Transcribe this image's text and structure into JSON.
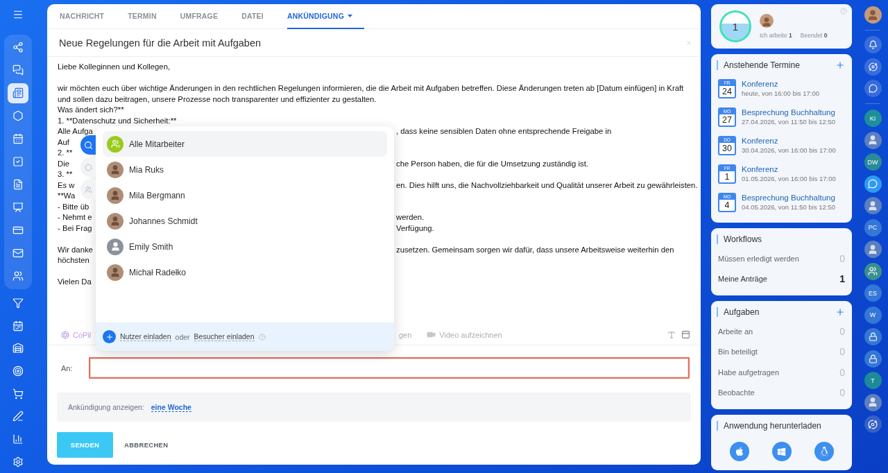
{
  "sidebar": {
    "items": [
      {
        "grouped": true,
        "selected": false
      },
      {
        "grouped": true,
        "selected": false
      },
      {
        "grouped": true,
        "selected": true
      },
      {
        "grouped": true,
        "selected": false
      },
      {
        "grouped": true,
        "selected": false
      },
      {
        "grouped": true,
        "selected": false
      },
      {
        "grouped": true,
        "selected": false
      },
      {
        "grouped": true,
        "selected": false
      },
      {
        "grouped": true,
        "selected": false
      },
      {
        "grouped": true,
        "selected": false
      },
      {
        "grouped": true,
        "selected": false
      },
      {
        "grouped": false,
        "selected": false
      },
      {
        "grouped": false,
        "selected": false
      },
      {
        "grouped": false,
        "selected": false
      },
      {
        "grouped": false,
        "selected": false
      },
      {
        "grouped": false,
        "selected": false
      },
      {
        "grouped": false,
        "selected": false
      },
      {
        "grouped": false,
        "selected": false
      },
      {
        "grouped": false,
        "selected": false
      }
    ]
  },
  "tabs": [
    {
      "label": "NACHRICHT",
      "selected": false,
      "has_menu": false
    },
    {
      "label": "TERMIN",
      "selected": false,
      "has_menu": false
    },
    {
      "label": "UMFRAGE",
      "selected": false,
      "has_menu": false
    },
    {
      "label": "DATEI",
      "selected": false,
      "has_menu": false
    },
    {
      "label": "ANKÜNDIGUNG",
      "selected": true,
      "has_menu": true
    }
  ],
  "title": "Neue Regelungen für die Arbeit mit Aufgaben",
  "body_lines": [
    {
      "left": "Liebe Kolleginnen und Kollegen,"
    },
    {
      "left": "wir möchten euch über wichtige Änderungen in den rechtlichen Regelungen informieren, die die Arbeit mit Aufgaben betreffen. Diese Änderungen treten ab [Datum einfügen] in Kraft",
      "space_before": true
    },
    {
      "left": "und sollen dazu beitragen, unsere Prozesse noch transparenter und effizienter zu gestalten."
    },
    {
      "left": "Was ändert sich?**"
    },
    {
      "left": "1. **Datenschutz und Sicherheit:**"
    },
    {
      "left": "Alle Aufga",
      "right": ", dass keine sensiblen Daten ohne entsprechende Freigabe in"
    },
    {
      "left": "Auf"
    },
    {
      "left": "2. **"
    },
    {
      "left": "Die",
      "right": "che Person haben, die für die Umsetzung zuständig ist."
    },
    {
      "left": "3. **"
    },
    {
      "left": "Es w",
      "right": "en. Dies hilft uns, die Nachvollziehbarkeit und Qualität unserer Arbeit zu gewährleisten."
    },
    {
      "left": "**Wa"
    },
    {
      "left": "- Bitte üb"
    },
    {
      "left": "- Nehmt e",
      "right": "werden."
    },
    {
      "left": "- Bei Frag",
      "right": "Verfügung."
    },
    {
      "left": "Wir danke",
      "space_before": true,
      "right": "zusetzen. Gemeinsam sorgen wir dafür, dass unsere Arbeitsweise weiterhin den"
    },
    {
      "left": "höchsten"
    },
    {
      "left": "Vielen Da",
      "space_before": true
    }
  ],
  "toolbar": {
    "copilot": "CoPil",
    "fragment": "gen",
    "video": "Video aufzeichnen"
  },
  "popup": {
    "items": [
      {
        "name": "Alle Mitarbeiter",
        "kind": "group",
        "selected": true
      },
      {
        "name": "Mia Ruks",
        "kind": "photo",
        "selected": false
      },
      {
        "name": "Mila Bergmann",
        "kind": "photo",
        "selected": false
      },
      {
        "name": "Johannes Schmidt",
        "kind": "photo",
        "selected": false
      },
      {
        "name": "Emily Smith",
        "kind": "placeholder",
        "selected": false
      },
      {
        "name": "Michał Radełko",
        "kind": "photo",
        "selected": false
      }
    ],
    "invite_users": "Nutzer einladen",
    "or": "oder",
    "invite_guests": "Besucher einladen"
  },
  "recipient": {
    "label": "An:",
    "highlighted": true
  },
  "display": {
    "label": "Ankündigung anzeigen:",
    "value": "eine Woche"
  },
  "buttons": {
    "send": "SENDEN",
    "cancel": "ABBRECHEN"
  },
  "status": {
    "count": "1",
    "items": [
      {
        "label": "Ich arbeite",
        "count": "1"
      },
      {
        "label": "Beendet",
        "count": "0"
      }
    ]
  },
  "events": {
    "title": "Anstehende Termine",
    "items": [
      {
        "weekday": "FR",
        "day": "24",
        "title": "Konferenz",
        "time": "heute, von 16:00 bis 17:00"
      },
      {
        "weekday": "MO",
        "day": "27",
        "title": "Besprechung Buchhaltung",
        "time": "27.04.2026, von 11:50 bis 12:50"
      },
      {
        "weekday": "DO",
        "day": "30",
        "title": "Konferenz",
        "time": "30.04.2026, von 16:00 bis 17:00"
      },
      {
        "weekday": "FR",
        "day": "1",
        "title": "Konferenz",
        "time": "01.05.2026, von 16:00 bis 17:00"
      },
      {
        "weekday": "MO",
        "day": "4",
        "title": "Besprechung Buchhaltung",
        "time": "04.05.2026, von 11:50 bis 12:50"
      }
    ]
  },
  "workflows": {
    "title": "Workflows",
    "rows": [
      {
        "label": "Müssen erledigt werden",
        "count": "0",
        "emphasis": false
      },
      {
        "label": "Meine Anträge",
        "count": "1",
        "emphasis": true
      }
    ]
  },
  "tasks": {
    "title": "Aufgaben",
    "rows": [
      {
        "label": "Arbeite an",
        "count": "0",
        "emphasis": false
      },
      {
        "label": "Bin beteiligt",
        "count": "0",
        "emphasis": false
      },
      {
        "label": "Habe aufgetragen",
        "count": "0",
        "emphasis": false
      },
      {
        "label": "Beobachte",
        "count": "0",
        "emphasis": false
      }
    ]
  },
  "download": {
    "title": "Anwendung herunterladen"
  },
  "contacts": [
    {
      "kind": "initials",
      "initials": "KI",
      "color": "#1d8f9a"
    },
    {
      "kind": "avatar"
    },
    {
      "kind": "initials",
      "initials": "DW",
      "color": "#2a8a98"
    },
    {
      "kind": "chat"
    },
    {
      "kind": "avatar"
    },
    {
      "kind": "initials",
      "initials": "PC",
      "color": "#3477d6"
    },
    {
      "kind": "avatar"
    },
    {
      "kind": "group"
    },
    {
      "kind": "initials",
      "initials": "ES",
      "color": "#3477d6"
    },
    {
      "kind": "initials",
      "initials": "W",
      "color": "#3477d6"
    },
    {
      "kind": "lock"
    },
    {
      "kind": "lock"
    },
    {
      "kind": "initials",
      "initials": "T",
      "color": "#1d8a98"
    },
    {
      "kind": "avatar"
    },
    {
      "kind": "spiral"
    }
  ]
}
